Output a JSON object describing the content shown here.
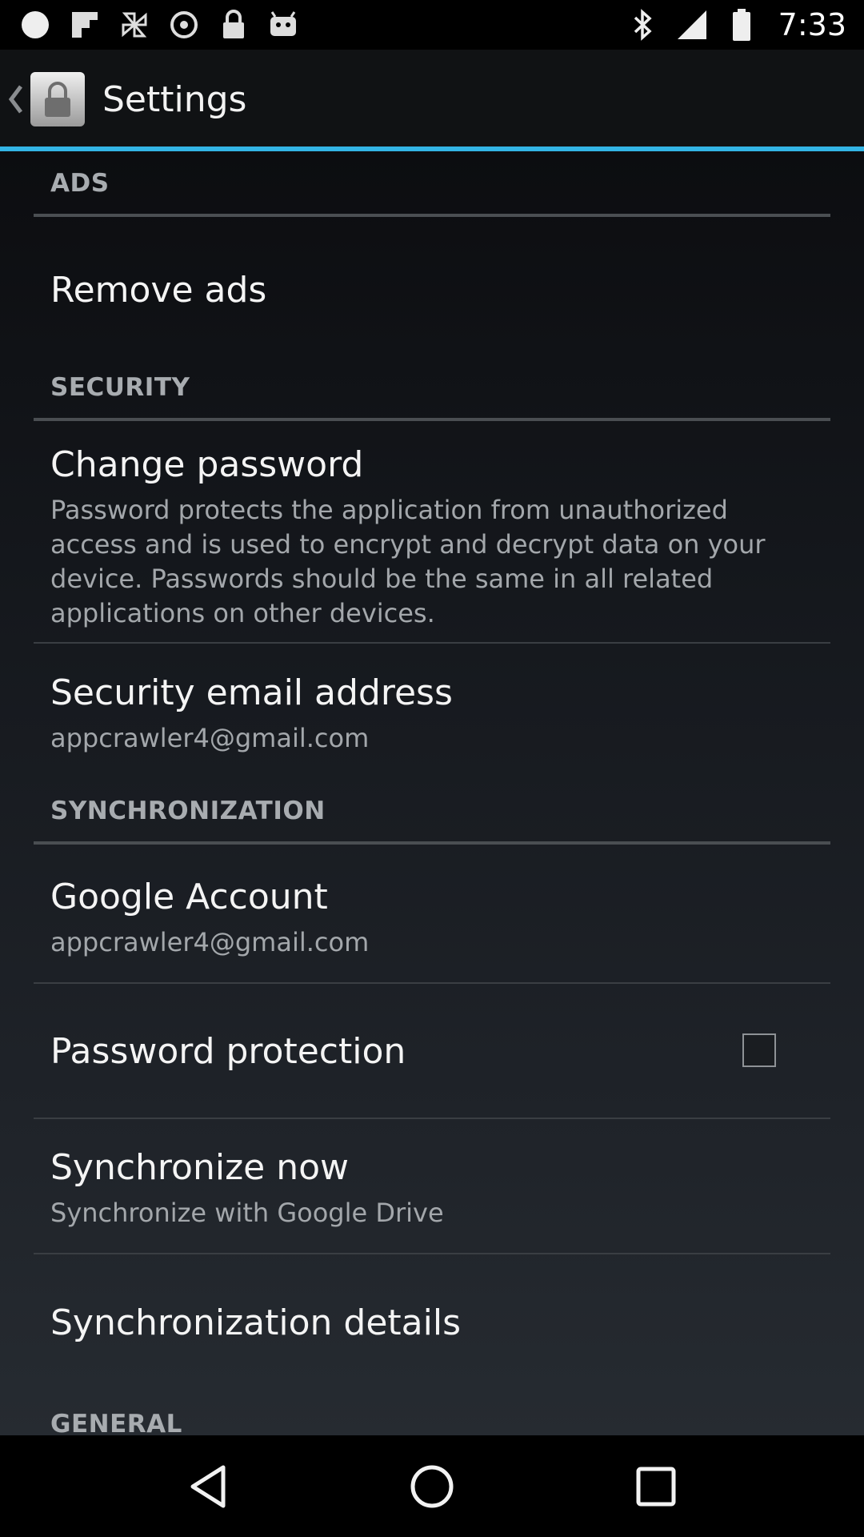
{
  "status_bar": {
    "time": "7:33",
    "icons": [
      "circle-icon",
      "flipboard-icon",
      "pinwheel-icon",
      "sync-icon",
      "lock-icon",
      "android-icon",
      "bluetooth-icon",
      "signal-icon",
      "battery-icon"
    ]
  },
  "action_bar": {
    "title": "Settings"
  },
  "sections": {
    "ads": {
      "label": "ADS"
    },
    "security": {
      "label": "SECURITY"
    },
    "synchronization": {
      "label": "SYNCHRONIZATION"
    },
    "general": {
      "label": "GENERAL"
    }
  },
  "items": {
    "remove_ads": {
      "title": "Remove ads"
    },
    "change_password": {
      "title": "Change password",
      "summary": "Password protects the application from unauthorized access and is used to encrypt and decrypt data on your device. Passwords should be the same in all related applications on other devices."
    },
    "security_email": {
      "title": "Security email address",
      "summary": "appcrawler4@gmail.com"
    },
    "google_account": {
      "title": "Google Account",
      "summary": "appcrawler4@gmail.com"
    },
    "password_protection": {
      "title": "Password protection",
      "checked": false
    },
    "synchronize_now": {
      "title": "Synchronize now",
      "summary": "Synchronize with Google Drive"
    },
    "sync_details": {
      "title": "Synchronization details"
    }
  },
  "colors": {
    "accent": "#33b5e5",
    "background": "#000000"
  }
}
